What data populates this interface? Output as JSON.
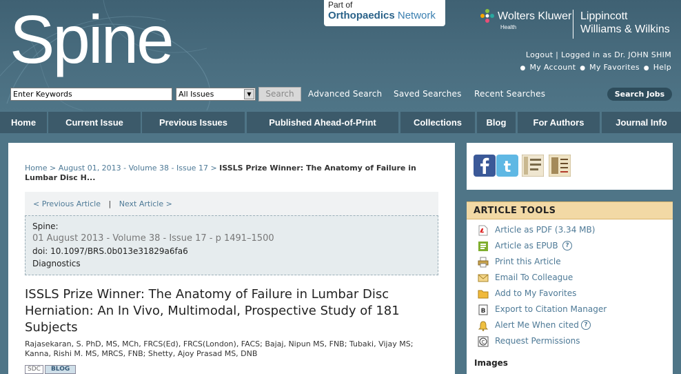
{
  "header": {
    "logo_text": "Spine",
    "network_badge": {
      "prefix": "Part of",
      "name_part1": "Orthopaedics",
      "name_part2": " Network"
    },
    "publisher": {
      "wk_name": "Wolters Kluwer",
      "wk_sub": "Health",
      "lww_line1": "Lippincott",
      "lww_line2": "Williams & Wilkins"
    },
    "user_links": {
      "logout": "Logout",
      "separator": "|",
      "logged_in": "Logged in as Dr. JOHN SHIM",
      "my_account": "My Account",
      "my_favorites": "My Favorites",
      "help": "Help"
    }
  },
  "search": {
    "input_value": "Enter Keywords",
    "select_value": "All Issues",
    "button_label": "Search",
    "advanced": "Advanced Search",
    "saved": "Saved Searches",
    "recent": "Recent Searches",
    "jobs": "Search Jobs"
  },
  "nav": {
    "items": [
      "Home",
      "Current Issue",
      "Previous Issues",
      "Published Ahead-of-Print",
      "Collections",
      "Blog",
      "For Authors",
      "Journal Info"
    ]
  },
  "breadcrumb": {
    "home": "Home",
    "sep": ">",
    "issue": "August 01, 2013 - Volume 38 - Issue 17",
    "current": "ISSLS Prize Winner: The Anatomy of Failure in Lumbar Disc H..."
  },
  "article_nav": {
    "previous": "< Previous Article",
    "sep": "|",
    "next": "Next Article >"
  },
  "citation": {
    "journal": "Spine:",
    "issue_line": "01 August 2013 - Volume 38 - Issue 17 - p 1491–1500",
    "doi": "doi: 10.1097/BRS.0b013e31829a6fa6",
    "section": "Diagnostics"
  },
  "article": {
    "title": "ISSLS Prize Winner: The Anatomy of Failure in Lumbar Disc Herniation: An In Vivo, Multimodal, Prospective Study of 181 Subjects",
    "authors": "Rajasekaran, S. PhD, MS, MCh, FRCS(Ed), FRCS(London), FACS; Bajaj, Nipun MS, FNB; Tubaki, Vijay MS; Kanna, Rishi M. MS, MRCS, FNB; Shetty, Ajoy Prasad MS, DNB",
    "badges": {
      "sdc": "SDC",
      "blog": "BLOG"
    }
  },
  "sidebar": {
    "tools_title": "ARTICLE TOOLS",
    "tools": [
      {
        "label": "Article as PDF (3.34 MB)",
        "icon": "pdf-icon"
      },
      {
        "label": "Article as EPUB",
        "icon": "epub-icon",
        "help": "?"
      },
      {
        "label": "Print this Article",
        "icon": "printer-icon"
      },
      {
        "label": "Email To Colleague",
        "icon": "envelope-icon"
      },
      {
        "label": "Add to My Favorites",
        "icon": "folder-icon"
      },
      {
        "label": "Export to Citation Manager",
        "icon": "export-icon"
      },
      {
        "label": "Alert Me When cited",
        "icon": "bell-icon",
        "help": "?"
      },
      {
        "label": "Request Permissions",
        "icon": "copyright-icon"
      }
    ],
    "images_heading": "Images"
  },
  "colors": {
    "header_bg": "#3f6173",
    "nav_tab": "#3c5a6a",
    "link": "#4d7996",
    "tools_header": "#f2d9a5"
  }
}
